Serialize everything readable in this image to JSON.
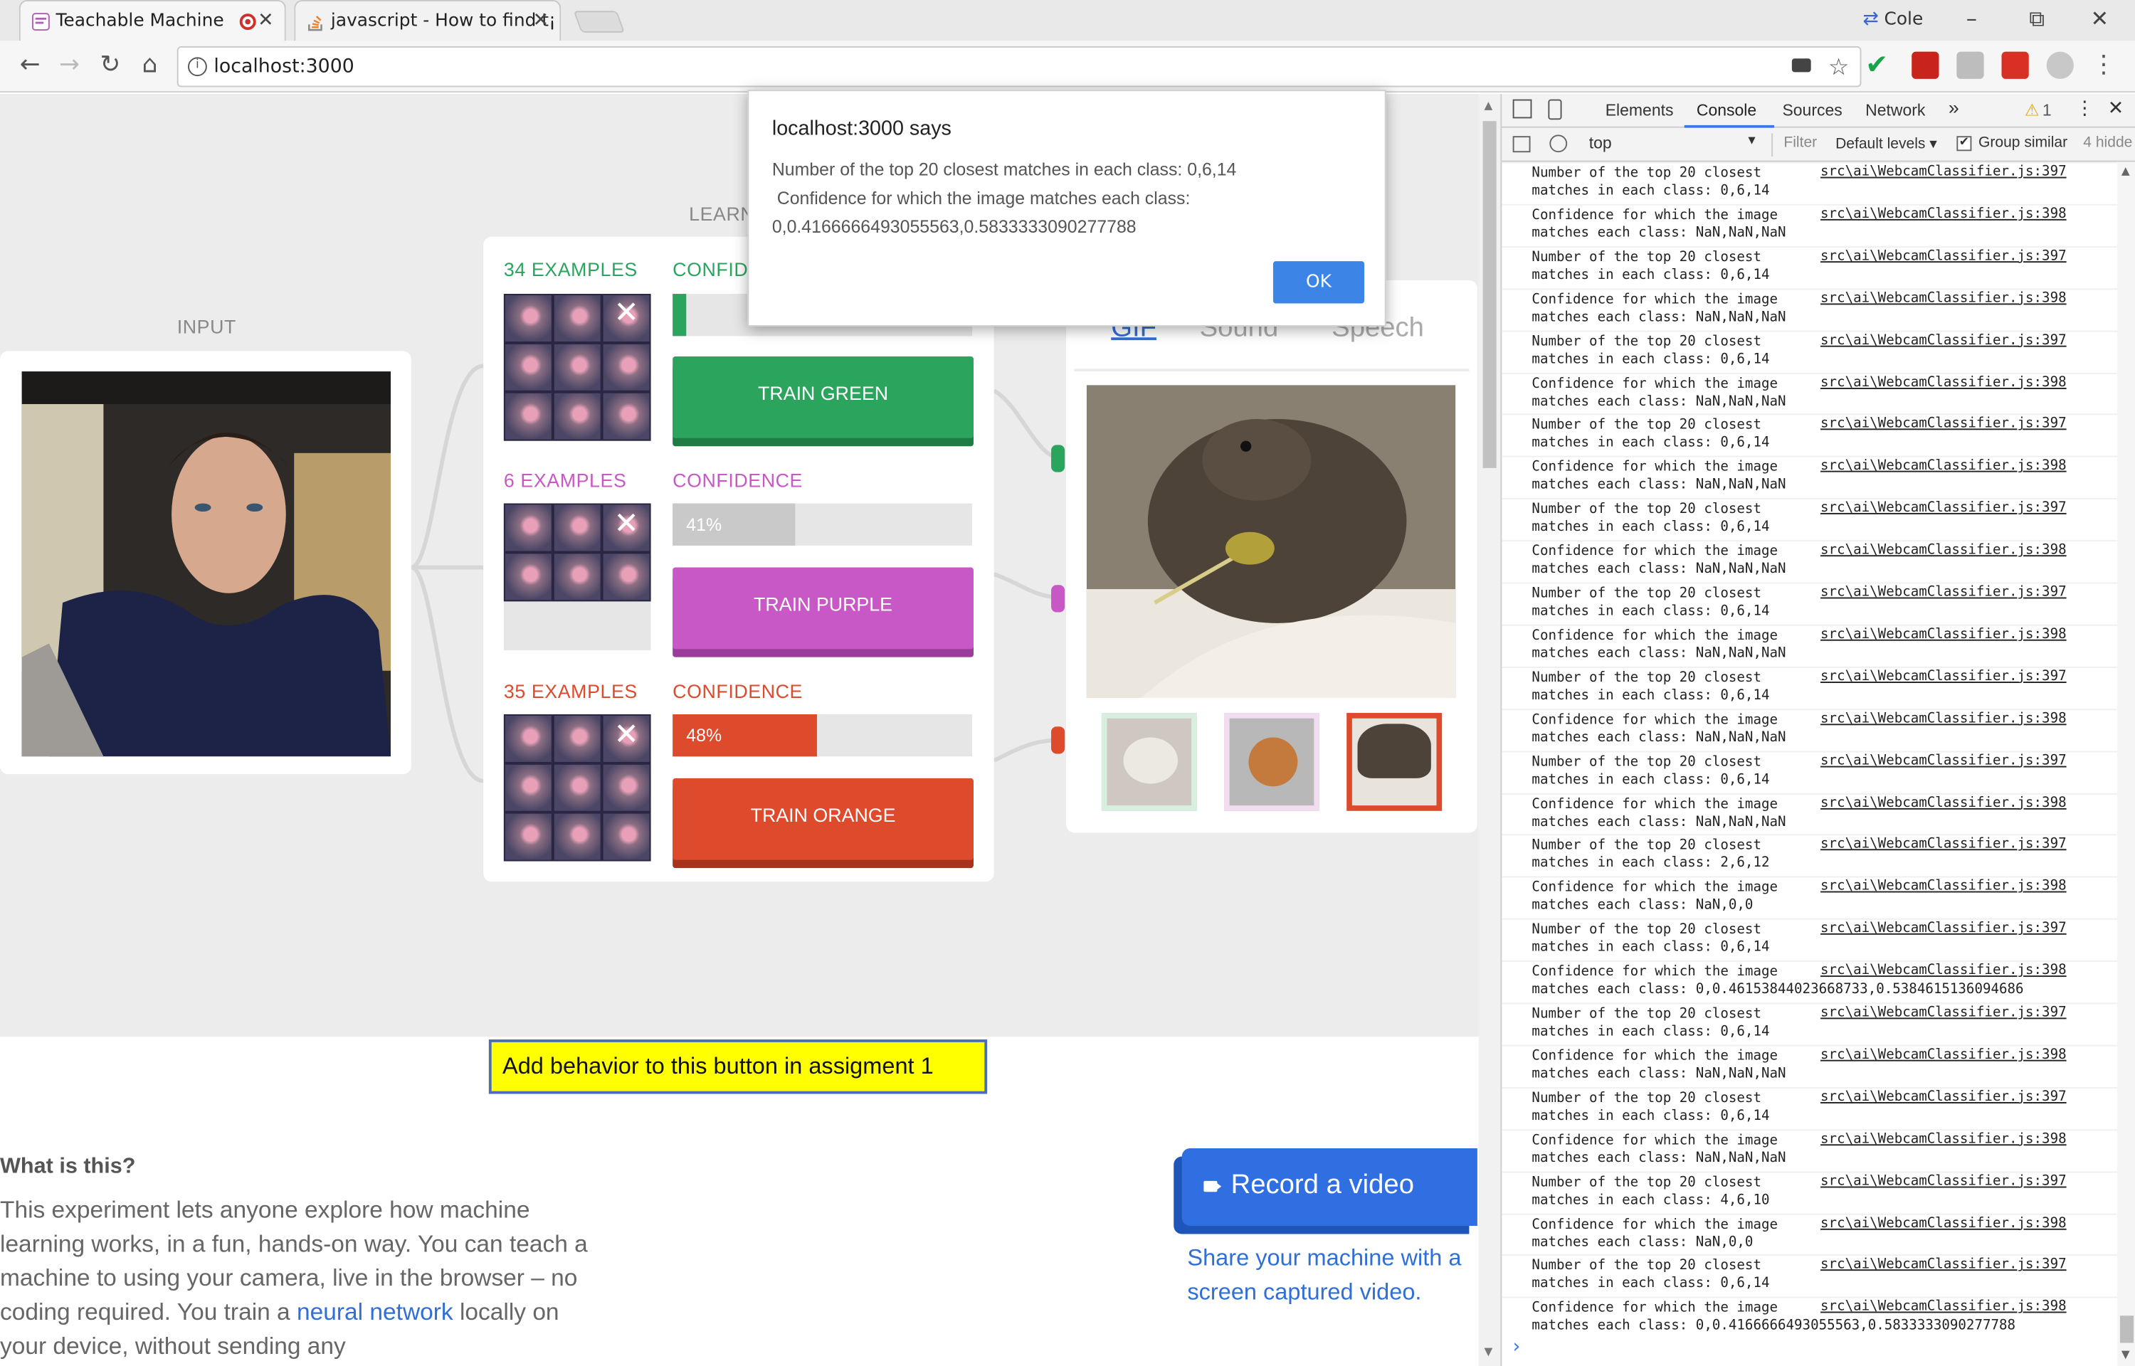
{
  "browser": {
    "tabs": [
      {
        "title": "Teachable Machine",
        "recording": true
      },
      {
        "title": "javascript - How to find t¡"
      }
    ],
    "profile": "Cole",
    "url": "localhost:3000",
    "window_controls": {
      "minimize": "–",
      "restore": "⧉",
      "close": "✕"
    }
  },
  "app": {
    "input_label": "INPUT",
    "learning_label": "LEARN",
    "classes": [
      {
        "examples": "34 EXAMPLES",
        "confidence_label": "CONFID",
        "confidence_text": "",
        "confidence_value": 0,
        "train_label": "TRAIN GREEN",
        "color": "#2ba55e"
      },
      {
        "examples": "6 EXAMPLES",
        "confidence_label": "CONFIDENCE",
        "confidence_text": "41%",
        "confidence_value": 0.41,
        "train_label": "TRAIN PURPLE",
        "color": "#c858c6"
      },
      {
        "examples": "35 EXAMPLES",
        "confidence_label": "CONFIDENCE",
        "confidence_text": "48%",
        "confidence_value": 0.48,
        "train_label": "TRAIN ORANGE",
        "color": "#de4a2c"
      }
    ],
    "output_tabs": [
      "GIF",
      "Sound",
      "Speech"
    ],
    "assignment_button": "Add behavior to this button in assigment 1",
    "what_title": "What is this?",
    "what_body_1": "This experiment lets anyone explore how machine learning works, in a fun, hands-on way. You can teach a machine to using your camera, live in the browser – no coding required. You train a ",
    "what_link_1": "neural",
    "what_link_2": "network",
    "what_body_2": " locally on your device, without sending any",
    "record_button": "Record a video",
    "record_caption": "Share your machine with a screen captured video."
  },
  "dialog": {
    "title": "localhost:3000 says",
    "line1": "Number of the top 20 closest matches in each class: 0,6,14",
    "line2": " Confidence for which the image matches each class:",
    "line3": "0,0.4166666493055563,0.5833333090277788",
    "ok_label": "OK"
  },
  "devtools": {
    "tabs": [
      "Elements",
      "Console",
      "Sources",
      "Network"
    ],
    "more": "»",
    "warnings": "1",
    "context": "top",
    "filter_placeholder": "Filter",
    "levels": "Default levels",
    "group_similar": "Group similar",
    "hidden": "4 hidde",
    "logs": [
      {
        "msg": "Number of the top 20 closest\nmatches in each class: 0,6,14",
        "src": "src\\ai\\WebcamClassifier.js:397"
      },
      {
        "msg": "Confidence for which the image\nmatches each class: NaN,NaN,NaN",
        "src": "src\\ai\\WebcamClassifier.js:398"
      },
      {
        "msg": "Number of the top 20 closest\nmatches in each class: 0,6,14",
        "src": "src\\ai\\WebcamClassifier.js:397"
      },
      {
        "msg": "Confidence for which the image\nmatches each class: NaN,NaN,NaN",
        "src": "src\\ai\\WebcamClassifier.js:398"
      },
      {
        "msg": "Number of the top 20 closest\nmatches in each class: 0,6,14",
        "src": "src\\ai\\WebcamClassifier.js:397"
      },
      {
        "msg": "Confidence for which the image\nmatches each class: NaN,NaN,NaN",
        "src": "src\\ai\\WebcamClassifier.js:398"
      },
      {
        "msg": "Number of the top 20 closest\nmatches in each class: 0,6,14",
        "src": "src\\ai\\WebcamClassifier.js:397"
      },
      {
        "msg": "Confidence for which the image\nmatches each class: NaN,NaN,NaN",
        "src": "src\\ai\\WebcamClassifier.js:398"
      },
      {
        "msg": "Number of the top 20 closest\nmatches in each class: 0,6,14",
        "src": "src\\ai\\WebcamClassifier.js:397"
      },
      {
        "msg": "Confidence for which the image\nmatches each class: NaN,NaN,NaN",
        "src": "src\\ai\\WebcamClassifier.js:398"
      },
      {
        "msg": "Number of the top 20 closest\nmatches in each class: 0,6,14",
        "src": "src\\ai\\WebcamClassifier.js:397"
      },
      {
        "msg": "Confidence for which the image\nmatches each class: NaN,NaN,NaN",
        "src": "src\\ai\\WebcamClassifier.js:398"
      },
      {
        "msg": "Number of the top 20 closest\nmatches in each class: 0,6,14",
        "src": "src\\ai\\WebcamClassifier.js:397"
      },
      {
        "msg": "Confidence for which the image\nmatches each class: NaN,NaN,NaN",
        "src": "src\\ai\\WebcamClassifier.js:398"
      },
      {
        "msg": "Number of the top 20 closest\nmatches in each class: 0,6,14",
        "src": "src\\ai\\WebcamClassifier.js:397"
      },
      {
        "msg": "Confidence for which the image\nmatches each class: NaN,NaN,NaN",
        "src": "src\\ai\\WebcamClassifier.js:398"
      },
      {
        "msg": "Number of the top 20 closest\nmatches in each class: 2,6,12",
        "src": "src\\ai\\WebcamClassifier.js:397"
      },
      {
        "msg": "Confidence for which the image\nmatches each class: NaN,0,0",
        "src": "src\\ai\\WebcamClassifier.js:398"
      },
      {
        "msg": "Number of the top 20 closest\nmatches in each class: 0,6,14",
        "src": "src\\ai\\WebcamClassifier.js:397"
      },
      {
        "msg": "Confidence for which the image\nmatches each class: 0,0.46153844023668733,0.5384615136094686",
        "src": "src\\ai\\WebcamClassifier.js:398"
      },
      {
        "msg": "Number of the top 20 closest\nmatches in each class: 0,6,14",
        "src": "src\\ai\\WebcamClassifier.js:397"
      },
      {
        "msg": "Confidence for which the image\nmatches each class: NaN,NaN,NaN",
        "src": "src\\ai\\WebcamClassifier.js:398"
      },
      {
        "msg": "Number of the top 20 closest\nmatches in each class: 0,6,14",
        "src": "src\\ai\\WebcamClassifier.js:397"
      },
      {
        "msg": "Confidence for which the image\nmatches each class: NaN,NaN,NaN",
        "src": "src\\ai\\WebcamClassifier.js:398"
      },
      {
        "msg": "Number of the top 20 closest\nmatches in each class: 4,6,10",
        "src": "src\\ai\\WebcamClassifier.js:397"
      },
      {
        "msg": "Confidence for which the image\nmatches each class: NaN,0,0",
        "src": "src\\ai\\WebcamClassifier.js:398"
      },
      {
        "msg": "Number of the top 20 closest\nmatches in each class: 0,6,14",
        "src": "src\\ai\\WebcamClassifier.js:397"
      },
      {
        "msg": "Confidence for which the image\nmatches each class: 0,0.4166666493055563,0.5833333090277788",
        "src": "src\\ai\\WebcamClassifier.js:398"
      }
    ],
    "prompt": "›"
  }
}
